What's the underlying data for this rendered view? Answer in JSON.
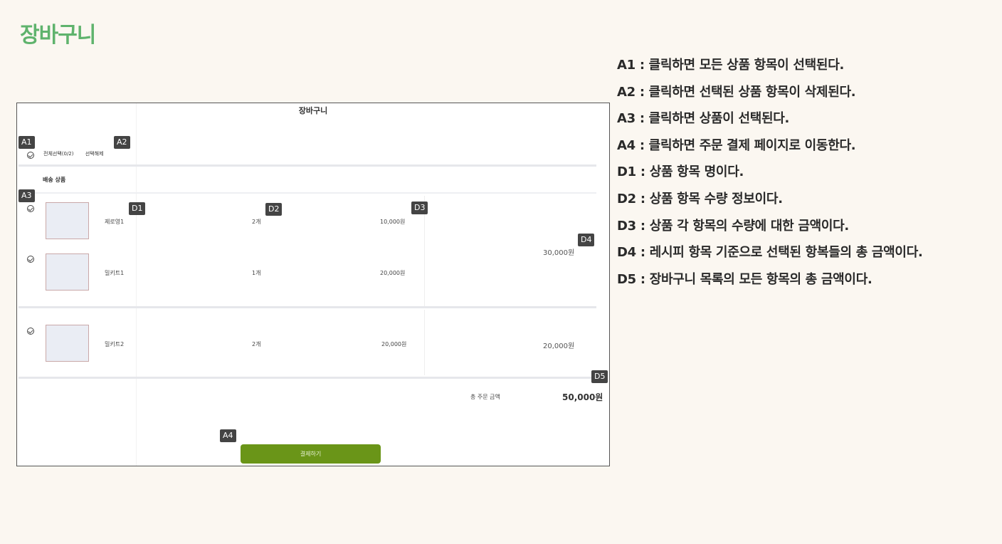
{
  "page_title": "장바구니",
  "mock": {
    "title": "장바구니",
    "select_all": "전체선택(0/2)",
    "deselect": "선택해제",
    "section": "배송 상품",
    "items": [
      {
        "name": "제로영1",
        "qty": "2개",
        "price": "10,000원"
      },
      {
        "name": "밀키트1",
        "qty": "1개",
        "price": "20,000원"
      },
      {
        "name": "밀키트2",
        "qty": "2개",
        "price": "20,000원"
      }
    ],
    "group_totals": [
      "30,000원",
      "20,000원"
    ],
    "total_label": "총 주문 금액",
    "total_value": "50,000원",
    "pay_button": "결제하기"
  },
  "tags": {
    "A1": "A1",
    "A2": "A2",
    "A3": "A3",
    "A4": "A4",
    "D1": "D1",
    "D2": "D2",
    "D3": "D3",
    "D4": "D4",
    "D5": "D5"
  },
  "notes": [
    "A1 : 클릭하면 모든 상품 항목이 선택된다.",
    "A2 : 클릭하면 선택된 상품 항목이 삭제된다.",
    "A3 : 클릭하면 상품이 선택된다.",
    "A4 : 클릭하면 주문 결제 페이지로 이동한다.",
    "D1 : 상품 항목 명이다.",
    "D2 : 상품 항목 수량 정보이다.",
    "D3 : 상품 각 항목의 수량에 대한 금액이다.",
    "D4 : 레시피 항목 기준으로 선택된 항복들의 총 금액이다.",
    "D5 : 장바구니 목록의 모든 항목의 총 금액이다."
  ]
}
